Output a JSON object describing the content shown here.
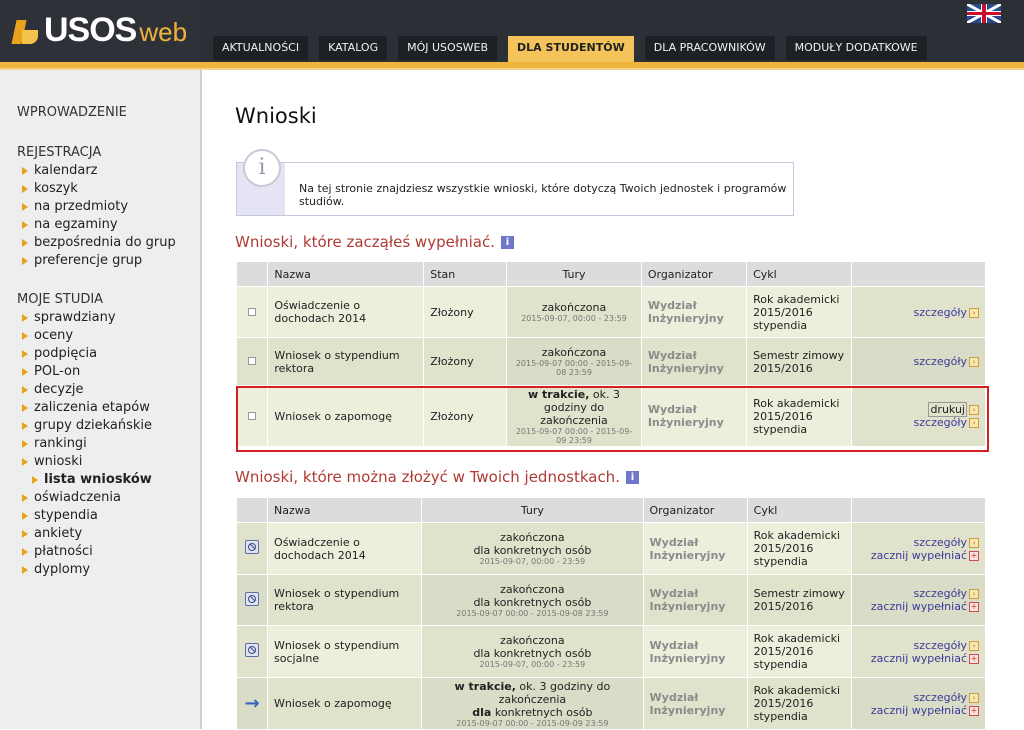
{
  "brand": {
    "name_a": "USOS",
    "name_b": "web"
  },
  "nav": {
    "tabs": [
      "AKTUALNOŚCI",
      "KATALOG",
      "MÓJ USOSWEB",
      "DLA STUDENTÓW",
      "DLA PRACOWNIKÓW",
      "MODUŁY DODATKOWE"
    ],
    "active": "DLA STUDENTÓW"
  },
  "sidebar": {
    "h1": "WPROWADZENIE",
    "h2": "REJESTRACJA",
    "reg": [
      "kalendarz",
      "koszyk",
      "na przedmioty",
      "na egzaminy",
      "bezpośrednia do grup",
      "preferencje grup"
    ],
    "h3": "MOJE STUDIA",
    "studia": [
      "sprawdziany",
      "oceny",
      "podpięcia",
      "POL-on",
      "decyzje",
      "zaliczenia etapów",
      "grupy dziekańskie",
      "rankingi",
      "wnioski"
    ],
    "sub": "lista wniosków",
    "studia2": [
      "oświadczenia",
      "stypendia",
      "ankiety",
      "płatności",
      "dyplomy"
    ]
  },
  "page": {
    "title": "Wnioski",
    "info": "Na tej stronie znajdziesz wszystkie wnioski, które dotyczą Twoich jednostek i programów studiów.",
    "info_icon": "i"
  },
  "section1": {
    "title": "Wnioski, które zacząłeś wypełniać.",
    "headers": [
      "Nazwa",
      "Stan",
      "Tury",
      "Organizator",
      "Cykl"
    ],
    "rows": [
      {
        "name": "Oświadczenie o dochodach 2014",
        "stan": "Złożony",
        "tury": "zakończona",
        "dates": "2015-09-07, 00:00 - 23:59",
        "org": "Wydział Inżynieryjny",
        "cykl": "Rok akademicki 2015/2016 stypendia",
        "link": "szczegóły"
      },
      {
        "name": "Wniosek o stypendium rektora",
        "stan": "Złożony",
        "tury": "zakończona",
        "dates": "2015-09-07 00:00 - 2015-09-08 23:59",
        "org": "Wydział Inżynieryjny",
        "cykl": "Semestr zimowy 2015/2016",
        "link": "szczegóły"
      },
      {
        "name": "Wniosek o zapomogę",
        "stan": "Złożony",
        "tury_bold": "w trakcie,",
        "tury": "ok. 3 godziny do zakończenia",
        "dates": "2015-09-07 00:00 - 2015-09-09 23:59",
        "org": "Wydział Inżynieryjny",
        "cykl": "Rok akademicki 2015/2016 stypendia",
        "print": "drukuj",
        "link": "szczegóły"
      }
    ]
  },
  "section2": {
    "title": "Wnioski, które można złożyć w Twoich jednostkach.",
    "headers": [
      "Nazwa",
      "Tury",
      "Organizator",
      "Cykl"
    ],
    "rows": [
      {
        "name": "Oświadczenie o dochodach 2014",
        "tury": "zakończona",
        "tury2": "dla konkretnych osób",
        "dates": "2015-09-07, 00:00 - 23:59",
        "org": "Wydział Inżynieryjny",
        "cykl": "Rok akademicki 2015/2016 stypendia",
        "link": "szczegóły",
        "start": "zacznij wypełniać"
      },
      {
        "name": "Wniosek o stypendium rektora",
        "tury": "zakończona",
        "tury2": "dla konkretnych osób",
        "dates": "2015-09-07 00:00 - 2015-09-08 23:59",
        "org": "Wydział Inżynieryjny",
        "cykl": "Semestr zimowy 2015/2016",
        "link": "szczegóły",
        "start": "zacznij wypełniać"
      },
      {
        "name": "Wniosek o stypendium socjalne",
        "tury": "zakończona",
        "tury2": "dla konkretnych osób",
        "dates": "2015-09-07, 00:00 - 23:59",
        "org": "Wydział Inżynieryjny",
        "cykl": "Rok akademicki 2015/2016 stypendia",
        "link": "szczegóły",
        "start": "zacznij wypełniać"
      },
      {
        "name": "Wniosek o zapomogę",
        "tury_bold": "w trakcie,",
        "tury": "ok. 3 godziny do zakończenia",
        "tury2_bold": "dla",
        "tury2": "konkretnych osób",
        "dates": "2015-09-07 00:00 - 2015-09-09 23:59",
        "org": "Wydział Inżynieryjny",
        "cykl": "Rok akademicki 2015/2016 stypendia",
        "link": "szczegóły",
        "start": "zacznij wypełniać"
      }
    ]
  },
  "colors": {
    "accent": "#f0b43c",
    "section_title": "#b03a34",
    "highlight": "#d42020",
    "link": "#3a3a9a"
  }
}
